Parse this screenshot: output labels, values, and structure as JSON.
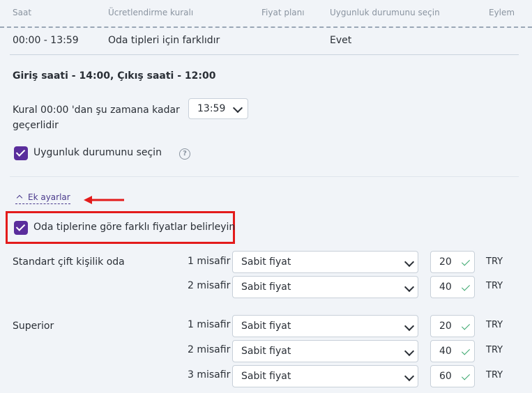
{
  "table_header": {
    "saat": "Saat",
    "rule": "Ücretlendirme kuralı",
    "plan": "Fiyat planı",
    "availability": "Uygunluk durumunu seçin",
    "action": "Eylem"
  },
  "row": {
    "time": "00:00 - 13:59",
    "rule": "Oda tipleri için farklıdır",
    "availability": "Evet"
  },
  "section_title": "Giriş saati - 14:00, Çıkış saati - 12:00",
  "rule_label": "Kural 00:00 'dan şu zamana kadar geçerlidir",
  "time_select_value": "13:59",
  "availability_checkbox_label": "Uygunluk durumunu seçin",
  "help_glyph": "?",
  "extra_settings_label": "Ek ayarlar",
  "room_prices_checkbox_label": "Oda tiplerine göre farklı fiyatlar belirleyin",
  "accent_color": "#5a2d9c",
  "highlight_color": "#e31b1b",
  "rooms": [
    {
      "name": "Standart çift kişilik oda",
      "rows": [
        {
          "guests": "1 misafir",
          "price_type": "Sabit fiyat",
          "amount": "20",
          "currency": "TRY"
        },
        {
          "guests": "2 misafir",
          "price_type": "Sabit fiyat",
          "amount": "40",
          "currency": "TRY"
        }
      ]
    },
    {
      "name": "Superior",
      "rows": [
        {
          "guests": "1 misafir",
          "price_type": "Sabit fiyat",
          "amount": "20",
          "currency": "TRY"
        },
        {
          "guests": "2 misafir",
          "price_type": "Sabit fiyat",
          "amount": "40",
          "currency": "TRY"
        },
        {
          "guests": "3 misafir",
          "price_type": "Sabit fiyat",
          "amount": "60",
          "currency": "TRY"
        }
      ]
    }
  ]
}
